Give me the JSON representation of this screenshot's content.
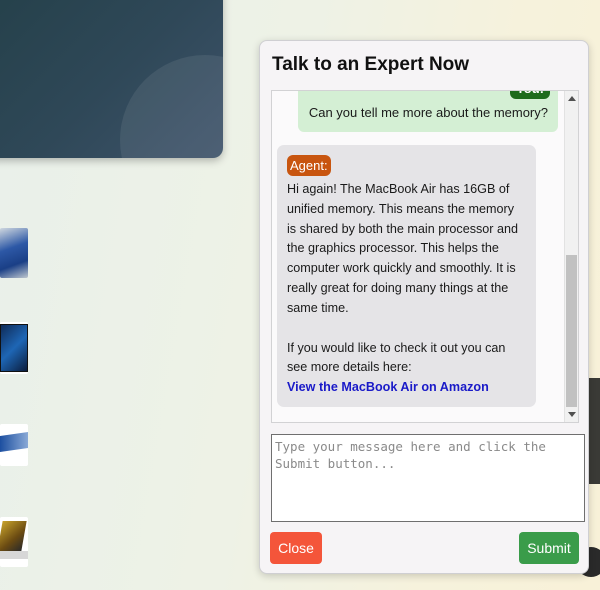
{
  "chat": {
    "title": "Talk to an Expert Now",
    "user_message": {
      "sender": "You:",
      "text": "Can you tell me more about the memory?"
    },
    "agent_message": {
      "sender": "Agent:",
      "paragraph1": "Hi again! The MacBook Air has 16GB of unified memory. This means the memory is shared by both the main processor and the graphics processor. This helps the computer work quickly and smoothly. It is really great for doing many things at the same time.",
      "paragraph2": "If you would like to check it out you can see more details here:",
      "link_text": "View the MacBook Air on Amazon"
    },
    "input_placeholder": "Type your message here and click the Submit button...",
    "close_label": "Close",
    "submit_label": "Submit"
  },
  "colors": {
    "user_bubble": "#d4efd4",
    "user_badge": "#1e6b1c",
    "agent_bubble": "#e5e4e7",
    "agent_badge": "#c8550f",
    "link": "#1a1ac8",
    "close_button": "#f4553a",
    "submit_button": "#3a9c4a"
  },
  "icons": [
    "scroll-up-arrow-icon",
    "scroll-down-arrow-icon"
  ]
}
